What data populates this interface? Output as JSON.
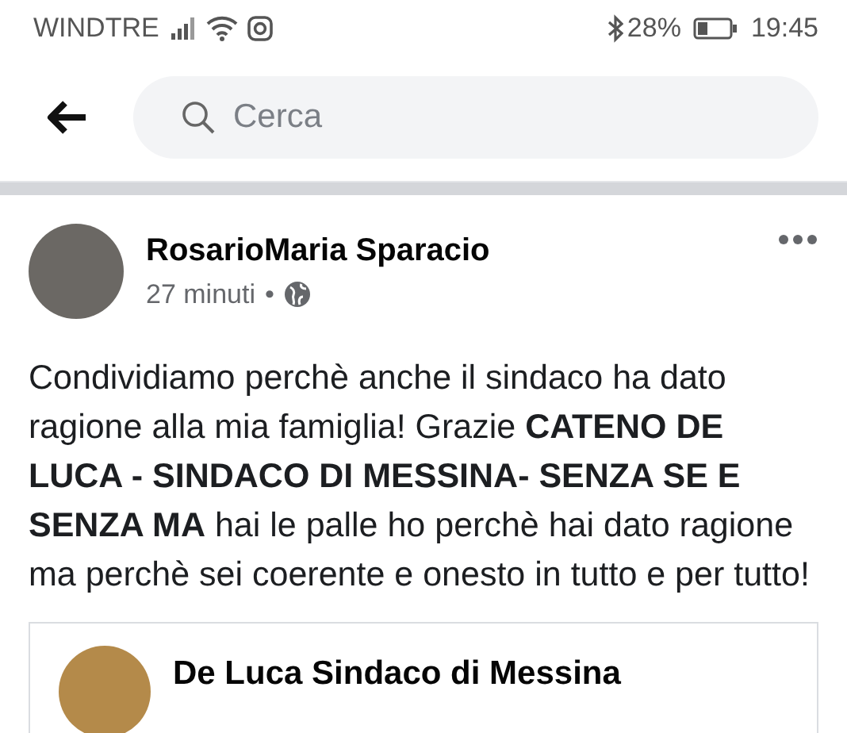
{
  "status_bar": {
    "carrier": "WINDTRE",
    "battery": "28%",
    "time": "19:45"
  },
  "search": {
    "placeholder": "Cerca"
  },
  "post": {
    "author": "RosarioMaria Sparacio",
    "time": "27 minuti",
    "separator": "•",
    "text": "Condividiamo perchè anche il sindaco ha dato ragione alla mia famiglia! Grazie **CATENO DE LUCA - SINDACO DI MESSINA- SENZA SE E SENZA MA** hai le palle ho perchè hai dato ragione ma perchè sei coerente e onesto in tutto e per tutto!",
    "shared": {
      "author": "De Luca Sindaco di Messina"
    }
  }
}
